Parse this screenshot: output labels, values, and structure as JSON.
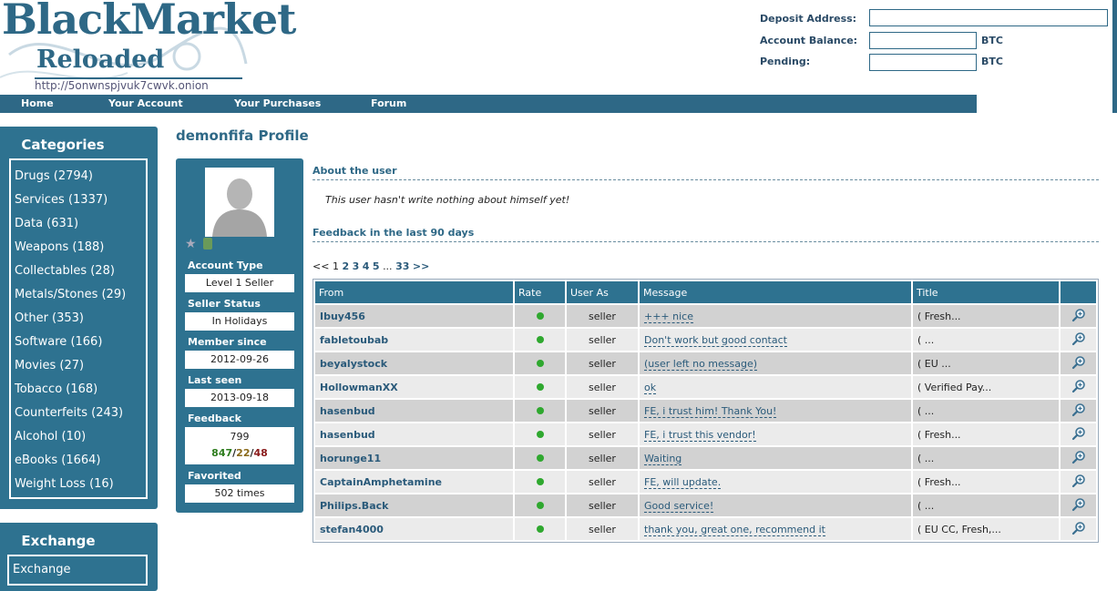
{
  "logo": {
    "line1": "BlackMarket",
    "line2": "Reloaded",
    "url": "http://5onwnspjvuk7cwvk.onion"
  },
  "header": {
    "deposit_label": "Deposit Address:",
    "deposit_value": "",
    "balance_label": "Account Balance:",
    "balance_value": "",
    "pending_label": "Pending:",
    "pending_value": "",
    "currency": "BTC"
  },
  "nav": [
    "Home",
    "Your Account",
    "Your Purchases",
    "Forum"
  ],
  "categories": {
    "title": "Categories",
    "items": [
      "Drugs (2794)",
      "Services (1337)",
      "Data (631)",
      "Weapons (188)",
      "Collectables (28)",
      "Metals/Stones (29)",
      "Other (353)",
      "Software (166)",
      "Movies (27)",
      "Tobacco (168)",
      "Counterfeits (243)",
      "Alcohol (10)",
      "eBooks (1664)",
      "Weight Loss (16)"
    ]
  },
  "exchange": {
    "title": "Exchange",
    "items": [
      "Exchange"
    ]
  },
  "profile": {
    "title": "demonfifa Profile",
    "account_type_label": "Account Type",
    "account_type": "Level 1 Seller",
    "seller_status_label": "Seller Status",
    "seller_status": "In Holidays",
    "member_since_label": "Member since",
    "member_since": "2012-09-26",
    "last_seen_label": "Last seen",
    "last_seen": "2013-09-18",
    "feedback_label": "Feedback",
    "feedback_total": "799",
    "feedback_pos": "847",
    "feedback_neu": "22",
    "feedback_neg": "48",
    "favorited_label": "Favorited",
    "favorited": "502 times"
  },
  "about": {
    "title": "About the user",
    "text": "This user hasn't write nothing about himself yet!"
  },
  "feedback": {
    "title": "Feedback in the last 90 days",
    "pager": {
      "prev": "<<",
      "current": "1",
      "pages": [
        "2",
        "3",
        "4",
        "5"
      ],
      "ellipsis": "...",
      "last": "33",
      "next": ">>"
    },
    "columns": [
      "From",
      "Rate",
      "User As",
      "Message",
      "Title",
      ""
    ],
    "rows": [
      {
        "from": "Ibuy456",
        "rate": "positive",
        "user_as": "seller",
        "message": "+++ nice",
        "title": "( Fresh..."
      },
      {
        "from": "fabletoubab",
        "rate": "positive",
        "user_as": "seller",
        "message": "Don't work but good contact",
        "title": "( ..."
      },
      {
        "from": "beyalystock",
        "rate": "positive",
        "user_as": "seller",
        "message": "(user left no message)",
        "title": "( EU ..."
      },
      {
        "from": "HollowmanXX",
        "rate": "positive",
        "user_as": "seller",
        "message": "ok",
        "title": "( Verified Pay..."
      },
      {
        "from": "hasenbud",
        "rate": "positive",
        "user_as": "seller",
        "message": "FE, i trust him! Thank You!",
        "title": "( ..."
      },
      {
        "from": "hasenbud",
        "rate": "positive",
        "user_as": "seller",
        "message": "FE, i trust this vendor!",
        "title": "( Fresh..."
      },
      {
        "from": "horunge11",
        "rate": "positive",
        "user_as": "seller",
        "message": "Waiting",
        "title": "( ..."
      },
      {
        "from": "CaptainAmphetamine",
        "rate": "positive",
        "user_as": "seller",
        "message": "FE, will update.",
        "title": "( Fresh..."
      },
      {
        "from": "Philips.Back",
        "rate": "positive",
        "user_as": "seller",
        "message": "Good service!",
        "title": "( ..."
      },
      {
        "from": "stefan4000",
        "rate": "positive",
        "user_as": "seller",
        "message": "thank you, great one, recommend it",
        "title": "( EU CC, Fresh,..."
      }
    ]
  },
  "colors": {
    "accent": "#2e7290",
    "positive": "#2fa82f",
    "neutral": "#8a6a1a",
    "negative": "#8a1a1a"
  }
}
